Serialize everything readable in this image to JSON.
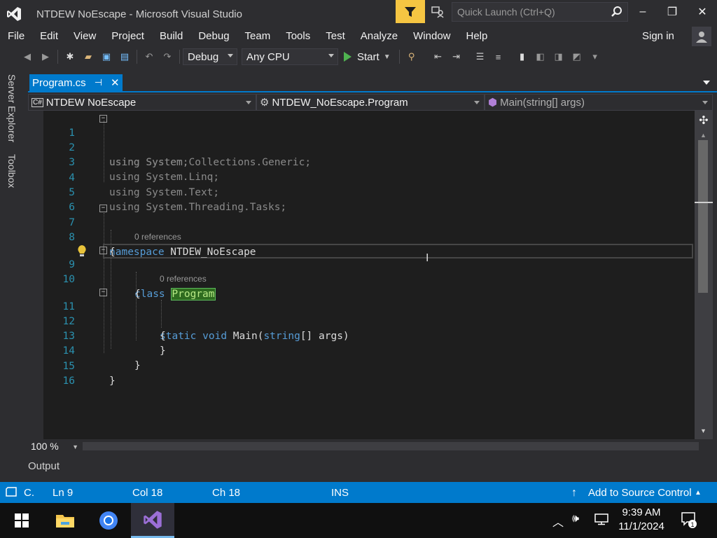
{
  "window": {
    "title": "NTDEW NoEscape - Microsoft Visual Studio",
    "quick_launch_placeholder": "Quick Launch (Ctrl+Q)",
    "minimize": "–",
    "maximize": "❐",
    "close": "✕"
  },
  "menu": {
    "items": [
      "File",
      "Edit",
      "View",
      "Project",
      "Build",
      "Debug",
      "Team",
      "Tools",
      "Test",
      "Analyze",
      "Window",
      "Help"
    ],
    "signin": "Sign in"
  },
  "toolbar": {
    "configuration": "Debug",
    "platform": "Any CPU",
    "start_label": "Start"
  },
  "sidebar": {
    "tabs": [
      "Server Explorer",
      "Toolbox"
    ]
  },
  "document": {
    "tab_label": "Program.cs"
  },
  "navbar": {
    "project": "NTDEW NoEscape",
    "class": "NTDEW_NoEscape.Program",
    "member": "Main(string[] args)"
  },
  "editor": {
    "references_label": "0 references",
    "lines": [
      {
        "num": "1",
        "text": "using System;"
      },
      {
        "num": "2",
        "text": "using System.Collections.Generic;"
      },
      {
        "num": "3",
        "text": "using System.Linq;"
      },
      {
        "num": "4",
        "text": "using System.Text;"
      },
      {
        "num": "5",
        "text": "using System.Threading.Tasks;"
      },
      {
        "num": "6",
        "text": ""
      },
      {
        "num": "7",
        "text": "namespace NTDEW_NoEscape"
      },
      {
        "num": "8",
        "text": "{"
      },
      {
        "num": "9",
        "text": "class Program"
      },
      {
        "num": "10",
        "text": "{"
      },
      {
        "num": "11",
        "text": "static void Main(string[] args)"
      },
      {
        "num": "12",
        "text": "{"
      },
      {
        "num": "13",
        "text": "}"
      },
      {
        "num": "14",
        "text": "}"
      },
      {
        "num": "15",
        "text": "}"
      },
      {
        "num": "16",
        "text": ""
      }
    ]
  },
  "zoom": {
    "level": "100 %"
  },
  "output": {
    "label": "Output"
  },
  "statusbar": {
    "mode": "C.",
    "line": "Ln 9",
    "col": "Col 18",
    "ch": "Ch 18",
    "ins": "INS",
    "source_control": "Add to Source Control"
  },
  "taskbar": {
    "time": "9:39 AM",
    "date": "11/1/2024",
    "notification_count": "1"
  },
  "colors": {
    "accent": "#007acc",
    "keyword": "#569cd6",
    "line_number": "#2b91af",
    "start_green": "#4fb350",
    "filter_yellow": "#f5c542"
  }
}
